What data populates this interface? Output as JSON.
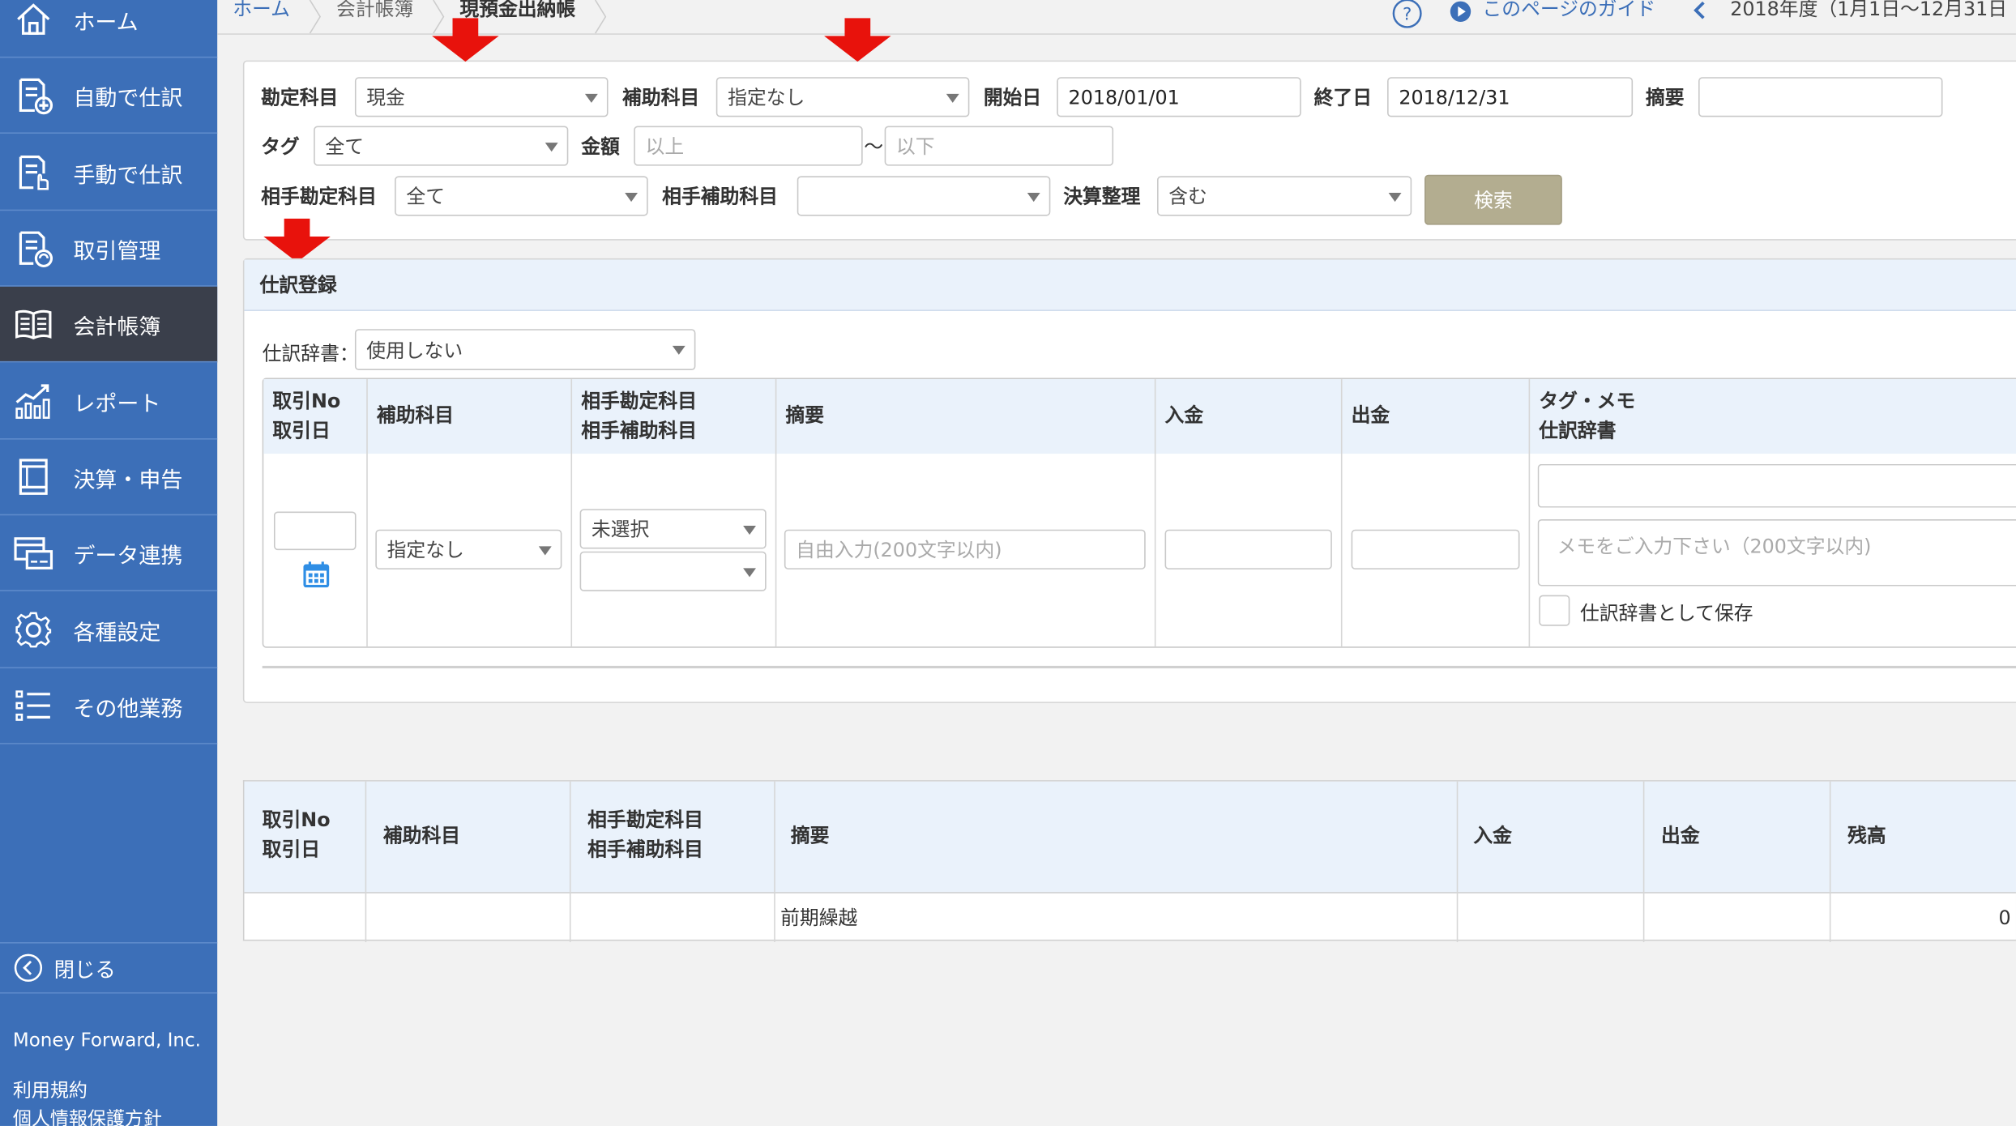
{
  "sidebar": {
    "items": [
      {
        "label": "ホーム",
        "icon": "home-icon"
      },
      {
        "label": "自動で仕訳",
        "icon": "auto-journal-icon"
      },
      {
        "label": "手動で仕訳",
        "icon": "manual-journal-icon"
      },
      {
        "label": "取引管理",
        "icon": "transaction-icon"
      },
      {
        "label": "会計帳簿",
        "icon": "ledger-book-icon"
      },
      {
        "label": "レポート",
        "icon": "report-chart-icon"
      },
      {
        "label": "決算・申告",
        "icon": "tax-filing-icon"
      },
      {
        "label": "データ連携",
        "icon": "data-link-icon"
      },
      {
        "label": "各種設定",
        "icon": "gear-icon"
      },
      {
        "label": "その他業務",
        "icon": "list-icon"
      }
    ],
    "active_index": 4,
    "close_label": "閉じる",
    "company": "Money Forward, Inc.",
    "links": [
      "利用規約",
      "個人情報保護方針"
    ]
  },
  "breadcrumb": [
    "ホーム",
    "会計帳簿",
    "現預金出納帳"
  ],
  "topbar": {
    "guide_label": "このページのガイド",
    "fiscal_year": "2018年度（1月1日〜12月31日"
  },
  "search": {
    "account_label": "勘定科目",
    "account_value": "現金",
    "sub_account_label": "補助科目",
    "sub_account_value": "指定なし",
    "start_label": "開始日",
    "start_value": "2018/01/01",
    "end_label": "終了日",
    "end_value": "2018/12/31",
    "memo_label": "摘要",
    "memo_value": "",
    "tag_label": "タグ",
    "tag_value": "全て",
    "amount_label": "金額",
    "amount_min_placeholder": "以上",
    "amount_sep": "〜",
    "amount_max_placeholder": "以下",
    "partner_account_label": "相手勘定科目",
    "partner_account_value": "全て",
    "partner_sub_label": "相手補助科目",
    "partner_sub_value": "",
    "closing_label": "決算整理",
    "closing_value": "含む",
    "search_button": "検索"
  },
  "entry": {
    "title": "仕訳登録",
    "dictionary_label": "仕訳辞書：",
    "dictionary_value": "使用しない",
    "headers": {
      "no_line1": "取引No",
      "no_line2": "取引日",
      "sub_account": "補助科目",
      "partner_line1": "相手勘定科目",
      "partner_line2": "相手補助科目",
      "memo": "摘要",
      "deposit": "入金",
      "withdrawal": "出金",
      "tag_line1": "タグ・メモ",
      "tag_line2": "仕訳辞書"
    },
    "sub_account_value": "指定なし",
    "partner_account_value": "未選択",
    "partner_sub_value": "",
    "memo_placeholder": "自由入力(200文字以内)",
    "note_placeholder": "メモをご入力下さい（200文字以内)",
    "save_dictionary_label": "仕訳辞書として保存"
  },
  "ledger": {
    "headers": {
      "no_line1": "取引No",
      "no_line2": "取引日",
      "sub_account": "補助科目",
      "partner_line1": "相手勘定科目",
      "partner_line2": "相手補助科目",
      "memo": "摘要",
      "deposit": "入金",
      "withdrawal": "出金",
      "balance": "残高"
    },
    "rows": [
      {
        "no": "",
        "sub_account": "",
        "partner": "",
        "memo": "前期繰越",
        "deposit": "",
        "withdrawal": "",
        "balance": "0"
      }
    ]
  },
  "colors": {
    "sidebar": "#3c6fb8",
    "sidebar_active": "#3a3f4b",
    "header_bg": "#eaf2fb",
    "search_button": "#b3ad90",
    "annotation_arrow": "#e8120c"
  }
}
